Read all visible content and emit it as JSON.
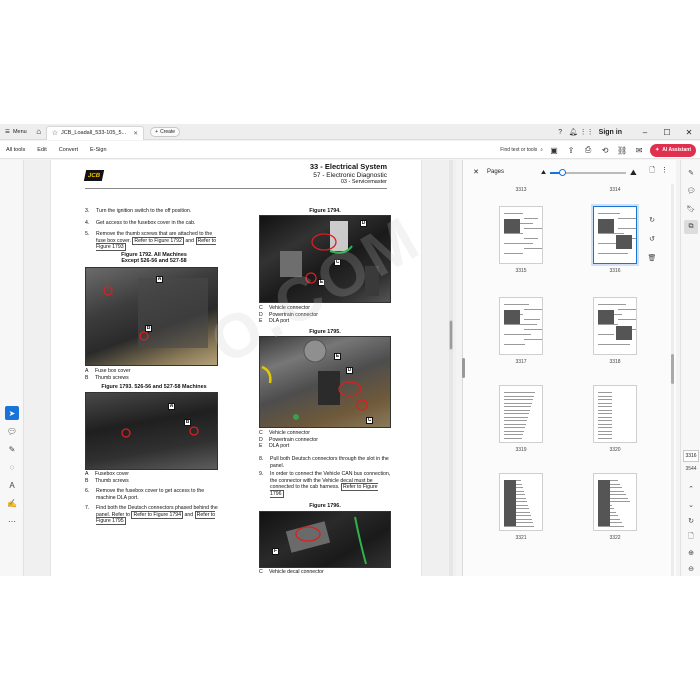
{
  "titlebar": {
    "menu_label": "Menu",
    "tab_title": "JCB_Loadall_533-105_5...",
    "create_label": "Create",
    "sign_in": "Sign in"
  },
  "toolbar": {
    "items": [
      "All tools",
      "Edit",
      "Convert",
      "E-Sign"
    ],
    "find_label": "Find text or tools",
    "ai_label": "AI Assistant"
  },
  "document": {
    "header_title": "33 - Electrical System",
    "header_sub": "57 - Electronic Diagnostic",
    "header_sub2": "03 - Servicemaster",
    "watermark": "O.COM",
    "steps": [
      {
        "n": "3.",
        "text": "Turn the ignition switch to the off position."
      },
      {
        "n": "4.",
        "text": "Get access to the fusebox cover in the cab."
      },
      {
        "n": "5.",
        "text": "Remove the thumb screws that are attached to the fuse box cover.",
        "ref1": "Refer to Figure 1792",
        "mid": "and",
        "ref2": "Refer to Figure 1793"
      },
      {
        "n": "6.",
        "text": "Remove the fusebox cover to get access to the machine DLA port."
      },
      {
        "n": "7.",
        "text": "Find both the Deutsch connectors phased behind the panel. Refer to",
        "ref1": "Refer to Figure 1794",
        "mid": "and",
        "ref2": "Refer to Figure 1795"
      },
      {
        "n": "8.",
        "text": "Pull both Deutsch connectors through the slot in the panel."
      },
      {
        "n": "9.",
        "text": "In order to connect the Vehicle CAN bus connection, the connector with the Vehicle decal must be connected to the cab harness.",
        "ref1": "Refer to Figure 1796"
      }
    ],
    "fig1792": {
      "title1": "Figure 1792. All Machines",
      "title2": "Except 526-56 and 527-58",
      "callouts": [
        "A",
        "B"
      ],
      "legend": [
        {
          "k": "A",
          "v": "Fuse box cover"
        },
        {
          "k": "B",
          "v": "Thumb screws"
        }
      ]
    },
    "fig1793": {
      "title": "Figure 1793. 526-56 and 527-58 Machines",
      "callouts": [
        "A",
        "B"
      ],
      "legend": [
        {
          "k": "A",
          "v": "Fusebox cover"
        },
        {
          "k": "B",
          "v": "Thumb screws"
        }
      ]
    },
    "fig1794": {
      "title": "Figure 1794.",
      "callouts": [
        "D",
        "C",
        "E"
      ],
      "legend": [
        {
          "k": "C",
          "v": "Vehicle connector"
        },
        {
          "k": "D",
          "v": "Powertrain connector"
        },
        {
          "k": "E",
          "v": "DLA port"
        }
      ]
    },
    "fig1795": {
      "title": "Figure 1795.",
      "callouts": [
        "E",
        "D",
        "C"
      ],
      "legend": [
        {
          "k": "C",
          "v": "Vehicle connector"
        },
        {
          "k": "D",
          "v": "Powertrain connector"
        },
        {
          "k": "E",
          "v": "DLA port"
        }
      ]
    },
    "fig1796": {
      "title": "Figure 1796.",
      "callouts": [
        "F"
      ],
      "legend": [
        {
          "k": "C",
          "v": "Vehicle decal connector"
        }
      ]
    }
  },
  "pages_panel": {
    "title": "Pages",
    "zoom_fraction": 0.16,
    "pages": [
      {
        "label": "3313",
        "thumb": false
      },
      {
        "label": "3314",
        "thumb": false
      },
      {
        "label": "3315",
        "thumb": true
      },
      {
        "label": "3316",
        "thumb": true,
        "selected": true
      },
      {
        "label": "3317",
        "thumb": true
      },
      {
        "label": "3318",
        "thumb": true
      },
      {
        "label": "3319",
        "thumb": true
      },
      {
        "label": "3320",
        "thumb": true
      },
      {
        "label": "3321",
        "thumb": true
      },
      {
        "label": "3322",
        "thumb": true
      }
    ]
  },
  "right_rail": {
    "current_page": "3316",
    "total_pages": "3544"
  },
  "colors": {
    "accent": "#1a73d9",
    "ai_button": "#e0304f",
    "jcb_yellow": "#f5c400",
    "annotation_red": "#d92020"
  }
}
